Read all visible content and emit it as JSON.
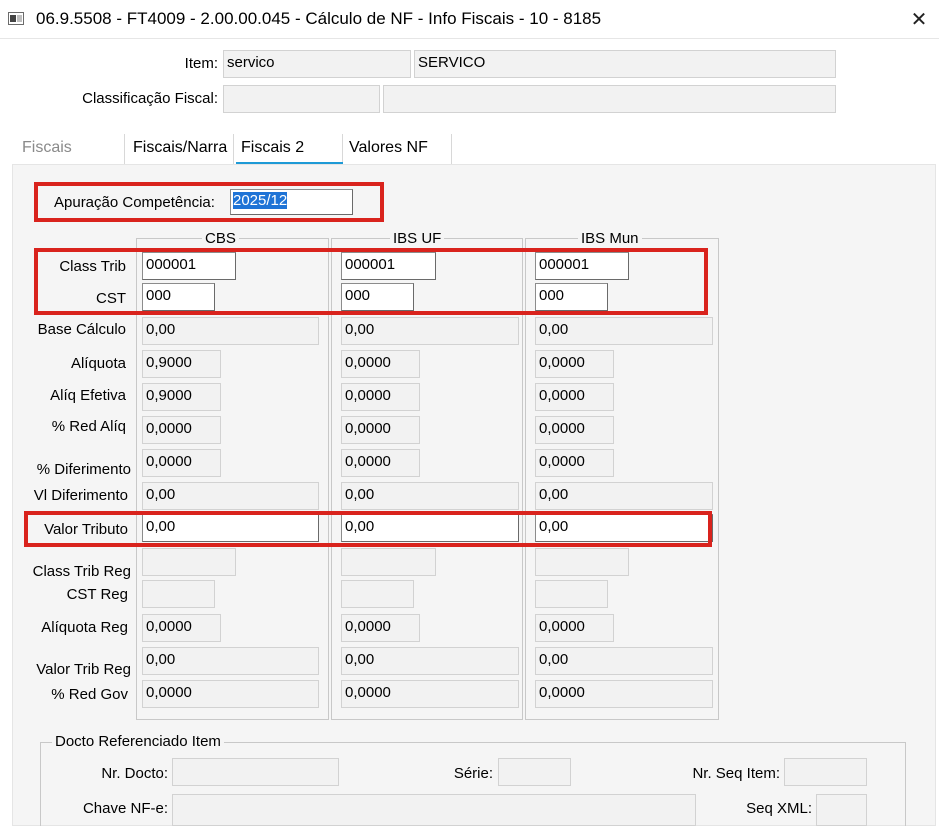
{
  "window": {
    "title": "06.9.5508 - FT4009 - 2.00.00.045 - Cálculo de NF - Info Fiscais - 10 - 8185",
    "close_glyph": "✕"
  },
  "header": {
    "item_label": "Item:",
    "item_code": "servico",
    "item_description": "SERVICO",
    "classificacao_label": "Classificação Fiscal:",
    "classificacao_code": "",
    "classificacao_description": ""
  },
  "tabs": [
    {
      "label": "Fiscais",
      "active": false,
      "disabled": true
    },
    {
      "label": "Fiscais/Narra",
      "active": false
    },
    {
      "label": "Fiscais 2",
      "active": true
    },
    {
      "label": "Valores NF",
      "active": false
    }
  ],
  "apuracao": {
    "label": "Apuração Competência:",
    "value": "2025/12"
  },
  "columns": [
    "CBS",
    "IBS UF",
    "IBS Mun"
  ],
  "row_labels": {
    "class_trib": "Class Trib",
    "cst": "CST",
    "base_calculo": "Base Cálculo",
    "aliquota": "Alíquota",
    "aliq_efetiva": "Alíq Efetiva",
    "red_aliq": "% Red Alíq",
    "diferimento": "% Diferimento",
    "vl_diferimento": "Vl Diferimento",
    "valor_tributo": "Valor Tributo",
    "class_trib_reg": "Class Trib Reg",
    "cst_reg": "CST Reg",
    "aliquota_reg": "Alíquota Reg",
    "valor_trib_reg": "Valor Trib Reg",
    "red_gov": "% Red Gov"
  },
  "cbs": {
    "class_trib": "000001",
    "cst": "000",
    "base_calculo": "0,00",
    "aliquota": "0,9000",
    "aliq_efetiva": "0,9000",
    "red_aliq": "0,0000",
    "diferimento": "0,0000",
    "vl_diferimento": "0,00",
    "valor_tributo": "0,00",
    "class_trib_reg": "",
    "cst_reg": "",
    "aliquota_reg": "0,0000",
    "valor_trib_reg": "0,00",
    "red_gov": "0,0000"
  },
  "ibs_uf": {
    "class_trib": "000001",
    "cst": "000",
    "base_calculo": "0,00",
    "aliquota": "0,0000",
    "aliq_efetiva": "0,0000",
    "red_aliq": "0,0000",
    "diferimento": "0,0000",
    "vl_diferimento": "0,00",
    "valor_tributo": "0,00",
    "class_trib_reg": "",
    "cst_reg": "",
    "aliquota_reg": "0,0000",
    "valor_trib_reg": "0,00",
    "red_gov": "0,0000"
  },
  "ibs_mun": {
    "class_trib": "000001",
    "cst": "000",
    "base_calculo": "0,00",
    "aliquota": "0,0000",
    "aliq_efetiva": "0,0000",
    "red_aliq": "0,0000",
    "diferimento": "0,0000",
    "vl_diferimento": "0,00",
    "valor_tributo": "0,00",
    "class_trib_reg": "",
    "cst_reg": "",
    "aliquota_reg": "0,0000",
    "valor_trib_reg": "0,00",
    "red_gov": "0,0000"
  },
  "docto": {
    "group_title": "Docto Referenciado Item",
    "nr_docto_label": "Nr. Docto:",
    "nr_docto": "",
    "serie_label": "Série:",
    "serie": "",
    "nr_seq_item_label": "Nr. Seq Item:",
    "nr_seq_item": "",
    "chave_label": "Chave NF-e:",
    "chave": "",
    "seq_xml_label": "Seq XML:",
    "seq_xml": ""
  },
  "colors": {
    "highlight_red": "#d9231d",
    "tab_underline": "#1e9ad6",
    "selection": "#1e73d6"
  }
}
